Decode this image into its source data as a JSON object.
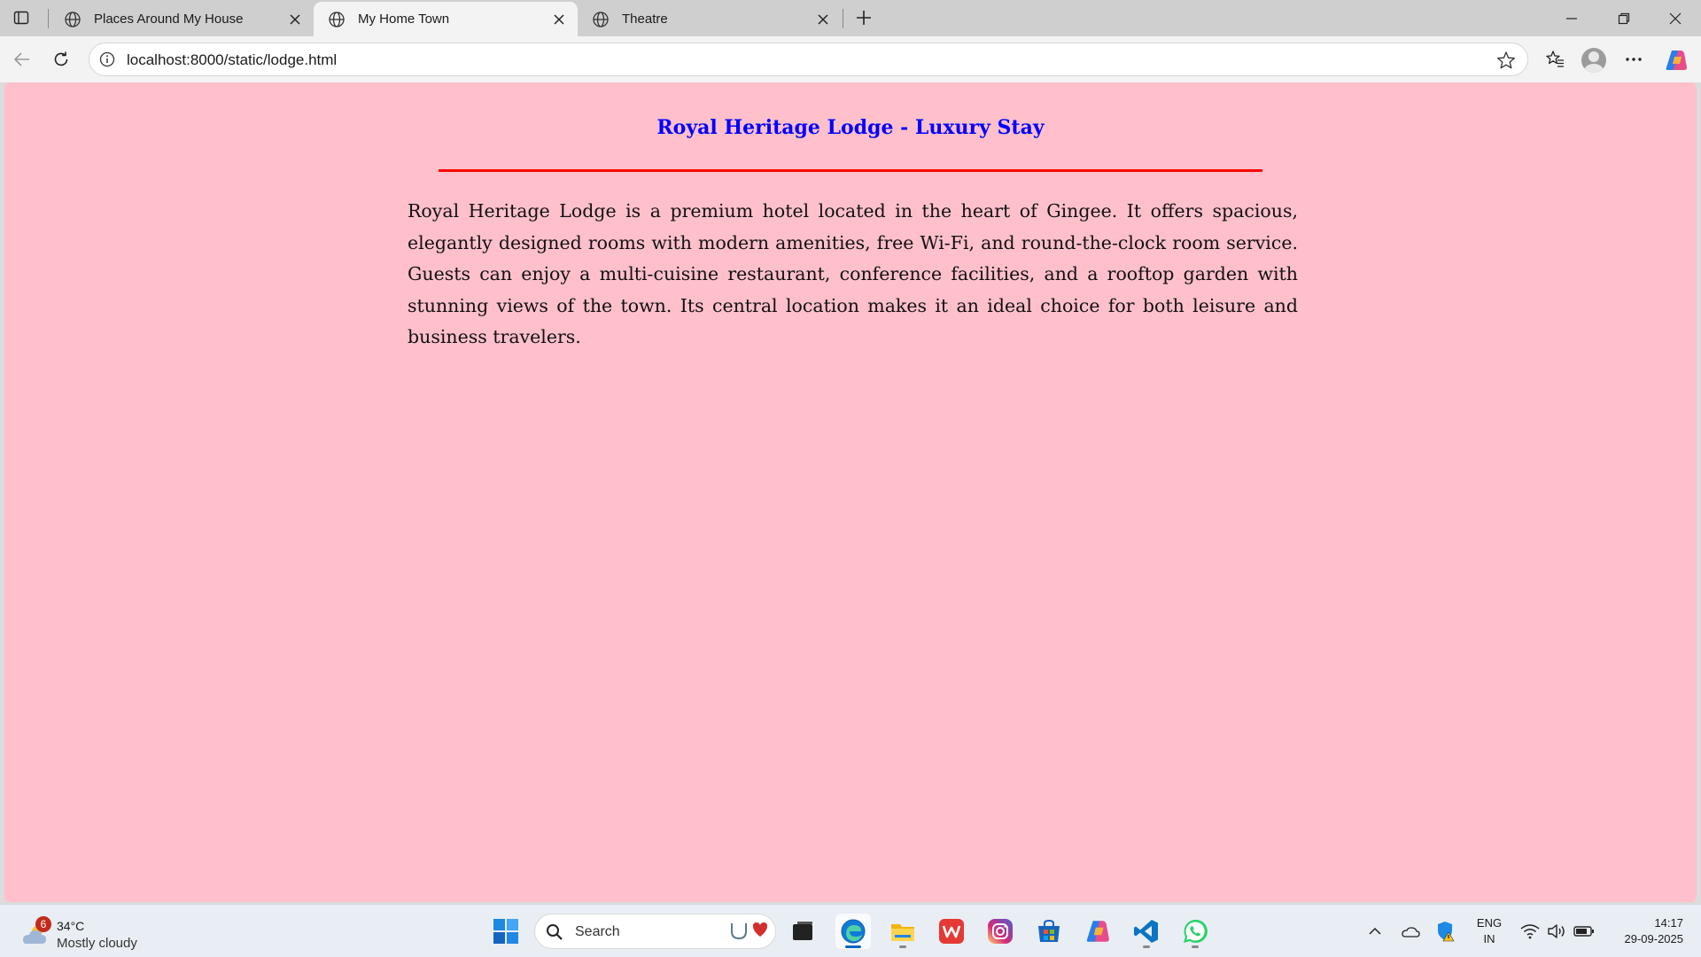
{
  "browser": {
    "tabs": [
      {
        "title": "Places Around My House",
        "active": false
      },
      {
        "title": "My Home Town",
        "active": true
      },
      {
        "title": "Theatre",
        "active": false
      }
    ],
    "url": "localhost:8000/static/lodge.html"
  },
  "page": {
    "heading": "Royal Heritage Lodge - Luxury Stay",
    "body": "Royal Heritage Lodge is a premium hotel located in the heart of Gingee. It offers spacious, elegantly designed rooms with modern amenities, free Wi-Fi, and round-the-clock room service. Guests can enjoy a multi-cuisine restaurant, conference facilities, and a rooftop garden with stunning views of the town. Its central location makes it an ideal choice for both leisure and business travelers.",
    "background_color": "#ffc0cb",
    "heading_color": "#0000ff",
    "rule_color": "#ff0000"
  },
  "taskbar": {
    "weather_badge": "6",
    "weather_temp": "34°C",
    "weather_condition": "Mostly cloudy",
    "search_label": "Search",
    "apps": [
      "windows-start-icon",
      "task-view-icon",
      "edge-icon",
      "file-explorer-icon",
      "wps-office-icon",
      "instagram-icon",
      "microsoft-store-icon",
      "copilot-icon",
      "vscode-icon",
      "whatsapp-icon"
    ],
    "lang_line1": "ENG",
    "lang_line2": "IN",
    "time": "14:17",
    "date": "29-09-2025"
  }
}
